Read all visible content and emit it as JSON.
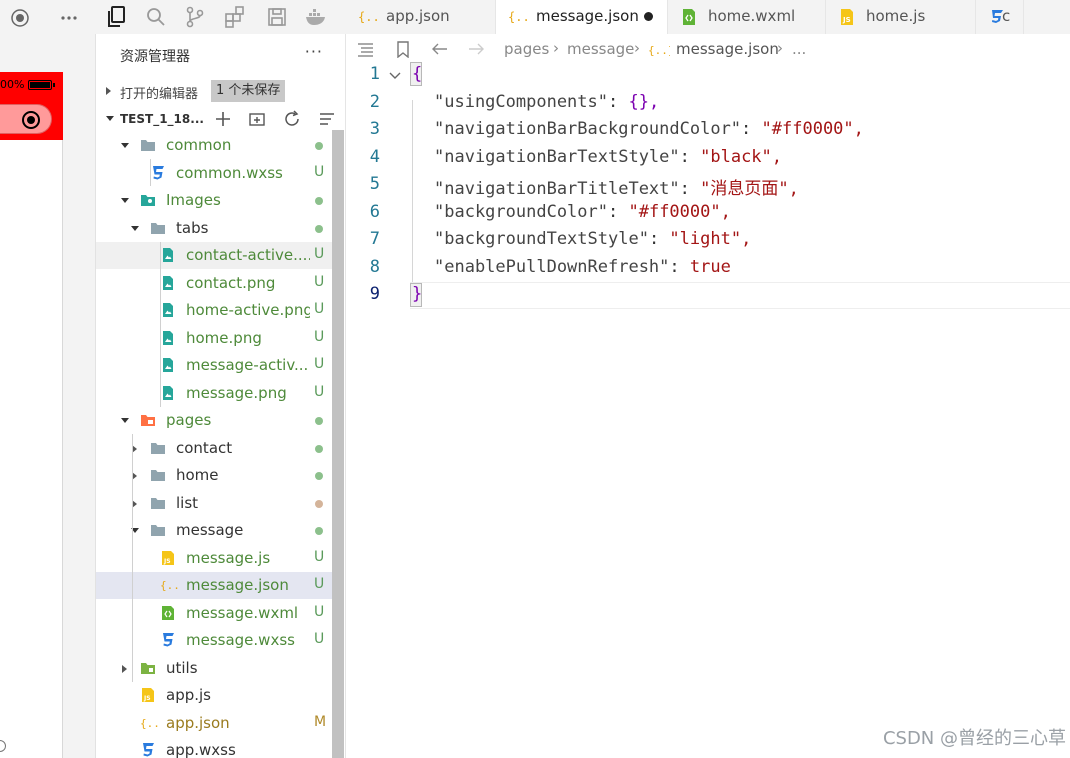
{
  "simulator": {
    "status_percent": "00%",
    "status_color": "#ff0000"
  },
  "explorer": {
    "title": "资源管理器",
    "more": "···",
    "open_editors_label": "打开的编辑器",
    "unsaved_badge": "1 个未保存",
    "project_name": "TEST_1_18...",
    "items": [
      {
        "label": "common",
        "status": "",
        "kind": "folder"
      },
      {
        "label": "common.wxss",
        "status": "U",
        "kind": "wxss"
      },
      {
        "label": "Images",
        "status": "",
        "kind": "folder-img"
      },
      {
        "label": "tabs",
        "status": "",
        "kind": "folder"
      },
      {
        "label": "contact-active....",
        "status": "U",
        "kind": "png"
      },
      {
        "label": "contact.png",
        "status": "U",
        "kind": "png"
      },
      {
        "label": "home-active.png",
        "status": "U",
        "kind": "png"
      },
      {
        "label": "home.png",
        "status": "U",
        "kind": "png"
      },
      {
        "label": "message-activ...",
        "status": "U",
        "kind": "png"
      },
      {
        "label": "message.png",
        "status": "U",
        "kind": "png"
      },
      {
        "label": "pages",
        "status": "",
        "kind": "folder-pages"
      },
      {
        "label": "contact",
        "status": "",
        "kind": "folder"
      },
      {
        "label": "home",
        "status": "",
        "kind": "folder"
      },
      {
        "label": "list",
        "status": "",
        "kind": "folder"
      },
      {
        "label": "message",
        "status": "",
        "kind": "folder"
      },
      {
        "label": "message.js",
        "status": "U",
        "kind": "js"
      },
      {
        "label": "message.json",
        "status": "U",
        "kind": "json"
      },
      {
        "label": "message.wxml",
        "status": "U",
        "kind": "wxml"
      },
      {
        "label": "message.wxss",
        "status": "U",
        "kind": "wxss"
      },
      {
        "label": "utils",
        "status": "",
        "kind": "folder-utils"
      },
      {
        "label": "app.js",
        "status": "",
        "kind": "js"
      },
      {
        "label": "app.json",
        "status": "M",
        "kind": "json"
      },
      {
        "label": "app.wxss",
        "status": "",
        "kind": "wxss"
      }
    ]
  },
  "tabs": [
    {
      "label": "app.json",
      "icon": "{..}"
    },
    {
      "label": "message.json",
      "icon": "{..}"
    },
    {
      "label": "home.wxml",
      "icon": "<>"
    },
    {
      "label": "home.js",
      "icon": "JS"
    },
    {
      "label": "c",
      "icon": "3"
    }
  ],
  "breadcrumbs": {
    "part1": "pages",
    "part2": "message",
    "part3": "message.json",
    "part4": "..."
  },
  "editor": {
    "line_numbers": [
      "1",
      "2",
      "3",
      "4",
      "5",
      "6",
      "7",
      "8",
      "9"
    ],
    "lines": [
      {
        "key": "",
        "value": "{"
      },
      {
        "key": "\"usingComponents\"",
        "value": "{},"
      },
      {
        "key": "\"navigationBarBackgroundColor\"",
        "value": "\"#ff0000\","
      },
      {
        "key": "\"navigationBarTextStyle\"",
        "value": "\"black\","
      },
      {
        "key": "\"navigationBarTitleText\"",
        "value": "\"消息页面\","
      },
      {
        "key": "\"backgroundColor\"",
        "value": "\"#ff0000\","
      },
      {
        "key": "\"backgroundTextStyle\"",
        "value": "\"light\","
      },
      {
        "key": "\"enablePullDownRefresh\"",
        "value": "true"
      },
      {
        "key": "",
        "value": "}"
      }
    ]
  },
  "watermark": "CSDN @曾经的三心草",
  "colors": {
    "accent_red": "#ff0000",
    "selected_row": "#e4e6f1",
    "string_color": "#a31515",
    "key_color": "#0451a5"
  }
}
